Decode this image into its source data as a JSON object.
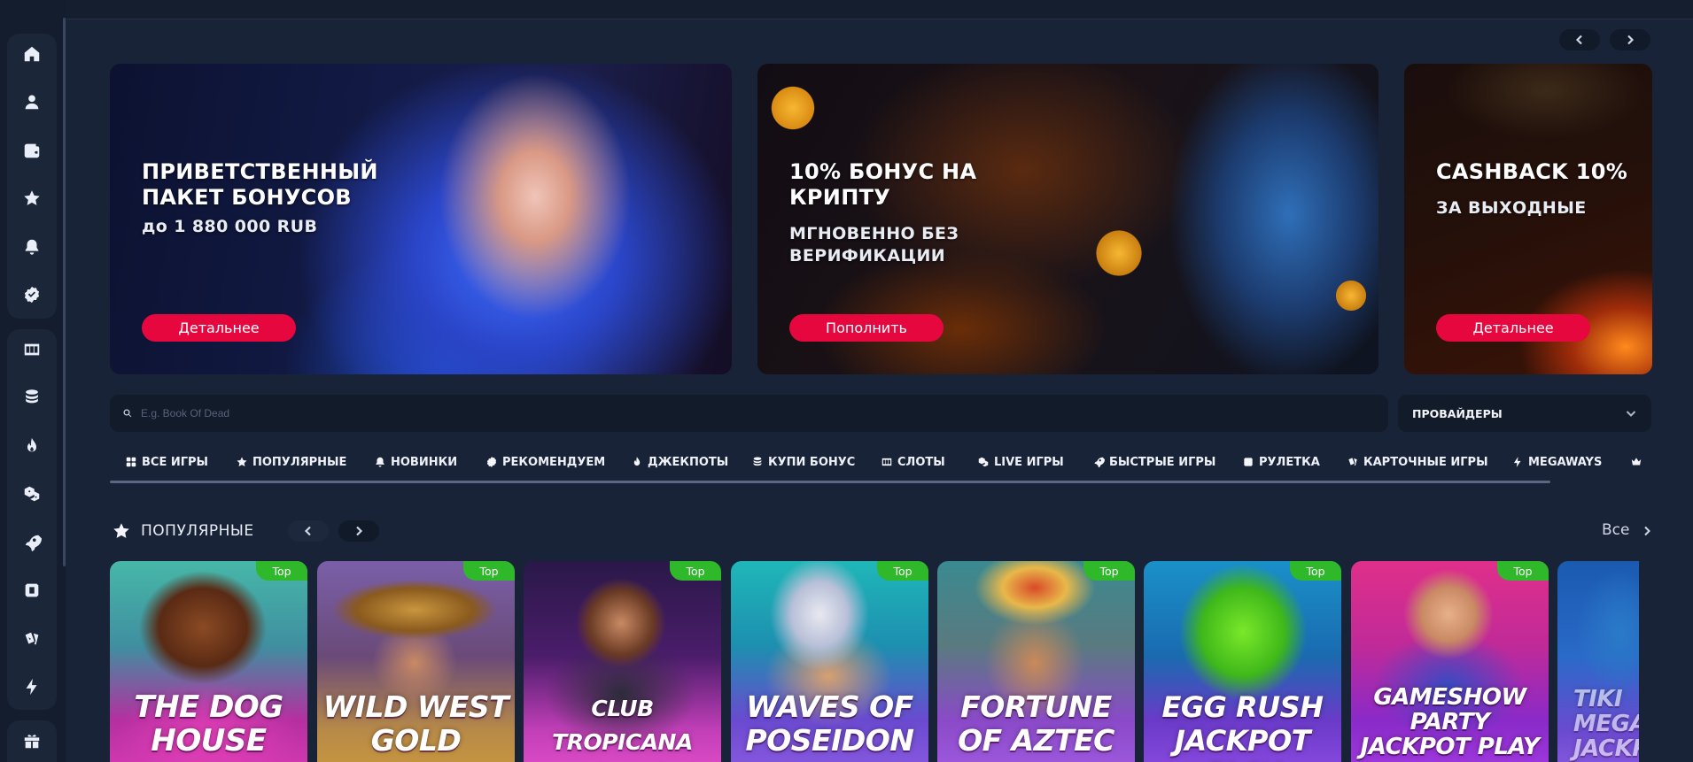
{
  "sidebar": {
    "items": [
      {
        "icon": "home-icon"
      },
      {
        "icon": "user-icon"
      },
      {
        "icon": "wallet-icon"
      },
      {
        "icon": "star-icon"
      },
      {
        "icon": "bell-icon"
      },
      {
        "icon": "verified-badge-icon"
      },
      {
        "icon": "slots-777-icon"
      },
      {
        "icon": "coin-stack-icon"
      },
      {
        "icon": "flame-icon"
      },
      {
        "icon": "dice-icon"
      },
      {
        "icon": "rocket-icon"
      },
      {
        "icon": "chip-icon"
      },
      {
        "icon": "cards-icon"
      },
      {
        "icon": "lightning-icon"
      },
      {
        "icon": "gift-icon"
      }
    ]
  },
  "banners": [
    {
      "title": "ПРИВЕТСТВЕННЫЙ\nПАКЕТ БОНУСОВ",
      "subtitle": "до 1 880 000 RUB",
      "button": "Детальнее"
    },
    {
      "title": "10% БОНУС НА\nКРИПТУ",
      "subtitle": "МГНОВЕННО БЕЗ\nВЕРИФИКАЦИИ",
      "button": "Пополнить"
    },
    {
      "title": "CASHBACK 10%",
      "subtitle": "ЗА ВЫХОДНЫЕ",
      "button": "Детальнее"
    }
  ],
  "search": {
    "placeholder": "E.g. Book Of Dead",
    "value": ""
  },
  "providers": {
    "label": "ПРОВАЙДЕРЫ"
  },
  "tabs": [
    {
      "label": "ВСЕ ИГРЫ",
      "icon": "grid-icon"
    },
    {
      "label": "ПОПУЛЯРНЫЕ",
      "icon": "star-icon"
    },
    {
      "label": "НОВИНКИ",
      "icon": "bell-icon"
    },
    {
      "label": "РЕКОМЕНДУЕМ",
      "icon": "verified-badge-icon"
    },
    {
      "label": "ДЖЕКПОТЫ",
      "icon": "flame-icon"
    },
    {
      "label": "КУПИ БОНУС",
      "icon": "coin-stack-icon"
    },
    {
      "label": "СЛОТЫ",
      "icon": "slots-777-icon"
    },
    {
      "label": "LIVE ИГРЫ",
      "icon": "dice-icon"
    },
    {
      "label": "БЫСТРЫЕ ИГРЫ",
      "icon": "rocket-icon"
    },
    {
      "label": "РУЛЕТКА",
      "icon": "chip-icon"
    },
    {
      "label": "КАРТОЧНЫЕ ИГРЫ",
      "icon": "cards-icon"
    },
    {
      "label": "MEGAWAYS",
      "icon": "lightning-icon"
    },
    {
      "label": "",
      "icon": "crown-icon"
    }
  ],
  "section": {
    "title": "ПОПУЛЯРНЫЕ",
    "all_label": "Все"
  },
  "games": [
    {
      "title": "THE DOG\nHOUSE",
      "badge": "Top"
    },
    {
      "title": "WILD WEST\nGOLD",
      "badge": "Top"
    },
    {
      "title": "CLUB TROPICANA\nHAPPY HOUR",
      "badge": "Top"
    },
    {
      "title": "WAVES OF\nPOSEIDON",
      "badge": "Top"
    },
    {
      "title": "FORTUNE\nOF AZTEC",
      "badge": "Top"
    },
    {
      "title": "EGG RUSH\nJACKPOT PLAY",
      "badge": "Top"
    },
    {
      "title": "GAMESHOW\nPARTY\nJACKPOT PLAY",
      "badge": "Top"
    },
    {
      "title": "TIKI\nMEGA\nJACKP",
      "badge": ""
    }
  ],
  "colors": {
    "accent": "#e6073f",
    "badge": "#2fb82a",
    "background": "#192337"
  }
}
